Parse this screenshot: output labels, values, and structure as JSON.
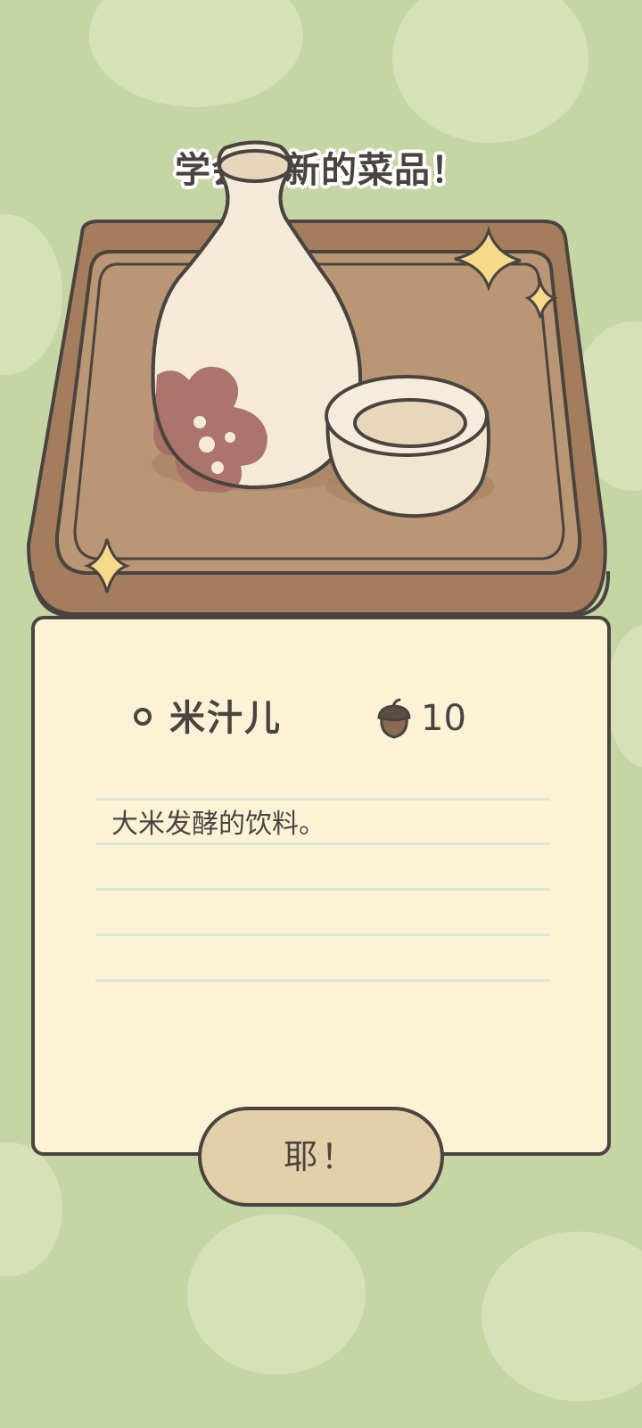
{
  "banner": {
    "title": "学会做新的菜品！"
  },
  "item": {
    "name": "米汁儿",
    "price": "10",
    "currency_icon": "acorn-icon",
    "description": "大米发酵的饮料。"
  },
  "actions": {
    "confirm_label": "耶！"
  },
  "colors": {
    "background": "#c6d5a4",
    "card": "#fcf3d7",
    "tray": "#b08a68",
    "outline": "#4a4440",
    "button": "#e3d0a8"
  },
  "icons": {
    "artwork": "sake-bottle-and-cup-on-tray",
    "sparkles": "sparkle-icon"
  }
}
